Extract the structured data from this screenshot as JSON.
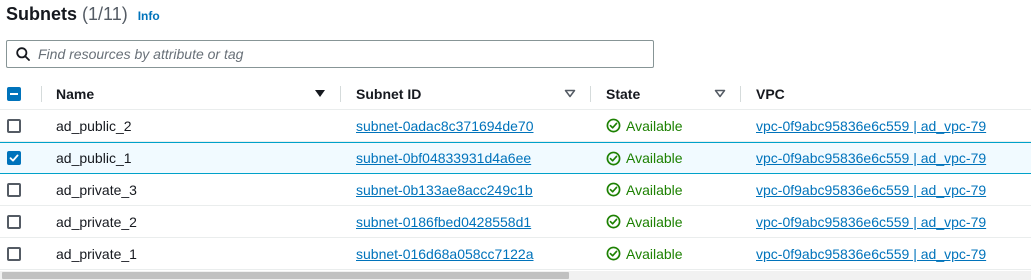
{
  "header": {
    "title": "Subnets",
    "count": "(1/11)",
    "info_label": "Info"
  },
  "search": {
    "placeholder": "Find resources by attribute or tag",
    "icon": "search-icon"
  },
  "table": {
    "columns": [
      {
        "label": "Name",
        "sort": "descending"
      },
      {
        "label": "Subnet ID",
        "sort": "none"
      },
      {
        "label": "State",
        "sort": "none"
      },
      {
        "label": "VPC",
        "sort": "none"
      }
    ],
    "select_all_state": "indeterminate",
    "rows": [
      {
        "name": "ad_public_2",
        "subnet_id": "subnet-0adac8c371694de70",
        "state": "Available",
        "vpc": "vpc-0f9abc95836e6c559 | ad_vpc-79",
        "selected": false
      },
      {
        "name": "ad_public_1",
        "subnet_id": "subnet-0bf04833931d4a6ee",
        "state": "Available",
        "vpc": "vpc-0f9abc95836e6c559 | ad_vpc-79",
        "selected": true
      },
      {
        "name": "ad_private_3",
        "subnet_id": "subnet-0b133ae8acc249c1b",
        "state": "Available",
        "vpc": "vpc-0f9abc95836e6c559 | ad_vpc-79",
        "selected": false
      },
      {
        "name": "ad_private_2",
        "subnet_id": "subnet-0186fbed0428558d1",
        "state": "Available",
        "vpc": "vpc-0f9abc95836e6c559 | ad_vpc-79",
        "selected": false
      },
      {
        "name": "ad_private_1",
        "subnet_id": "subnet-016d68a058cc7122a",
        "state": "Available",
        "vpc": "vpc-0f9abc95836e6c559 | ad_vpc-79",
        "selected": false
      }
    ]
  },
  "colors": {
    "link": "#0073bb",
    "available": "#1d8102",
    "selected_row_bg": "#f1faff",
    "selected_row_border": "#00a1c9",
    "checkbox_checked": "#0073bb"
  }
}
